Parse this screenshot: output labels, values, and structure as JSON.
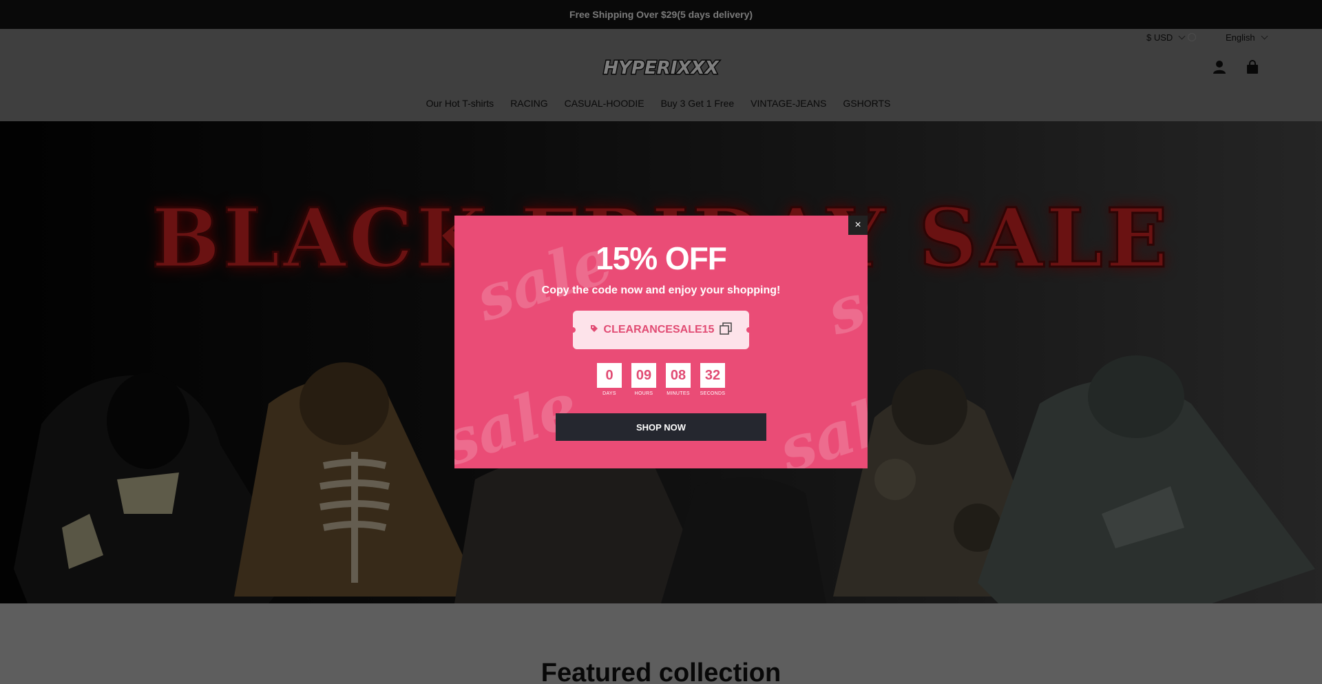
{
  "announcement": {
    "text": "Free Shipping Over $29(5 days delivery)"
  },
  "header": {
    "currency": "$ USD",
    "language": "English",
    "logo_text": "HYPERIXXX",
    "icons": {
      "account": "account-icon",
      "cart": "cart-icon"
    }
  },
  "nav": {
    "items": [
      {
        "label": "Our Hot T-shirts"
      },
      {
        "label": "RACING"
      },
      {
        "label": "CASUAL-HOODIE"
      },
      {
        "label": "Buy 3 Get 1 Free"
      },
      {
        "label": "VINTAGE-JEANS"
      },
      {
        "label": "GSHORTS"
      }
    ]
  },
  "hero": {
    "title": "BLACK FRIDAY SALE"
  },
  "featured": {
    "title": "Featured collection"
  },
  "popup": {
    "title": "15% OFF",
    "subtitle": "Copy the code now and enjoy your shopping!",
    "code": "CLEARANCESALE15",
    "close_label": "×",
    "watermark": "sale",
    "countdown": [
      {
        "value": "0",
        "label": "DAYS"
      },
      {
        "value": "09",
        "label": "HOURS"
      },
      {
        "value": "08",
        "label": "MINUTES"
      },
      {
        "value": "32",
        "label": "SECONDS"
      }
    ],
    "button_label": "SHOP NOW"
  },
  "colors": {
    "popup_bg": "#ea4c76",
    "code_bg": "#fde3ea",
    "button_bg": "#25272f",
    "hero_title": "#d42424"
  }
}
